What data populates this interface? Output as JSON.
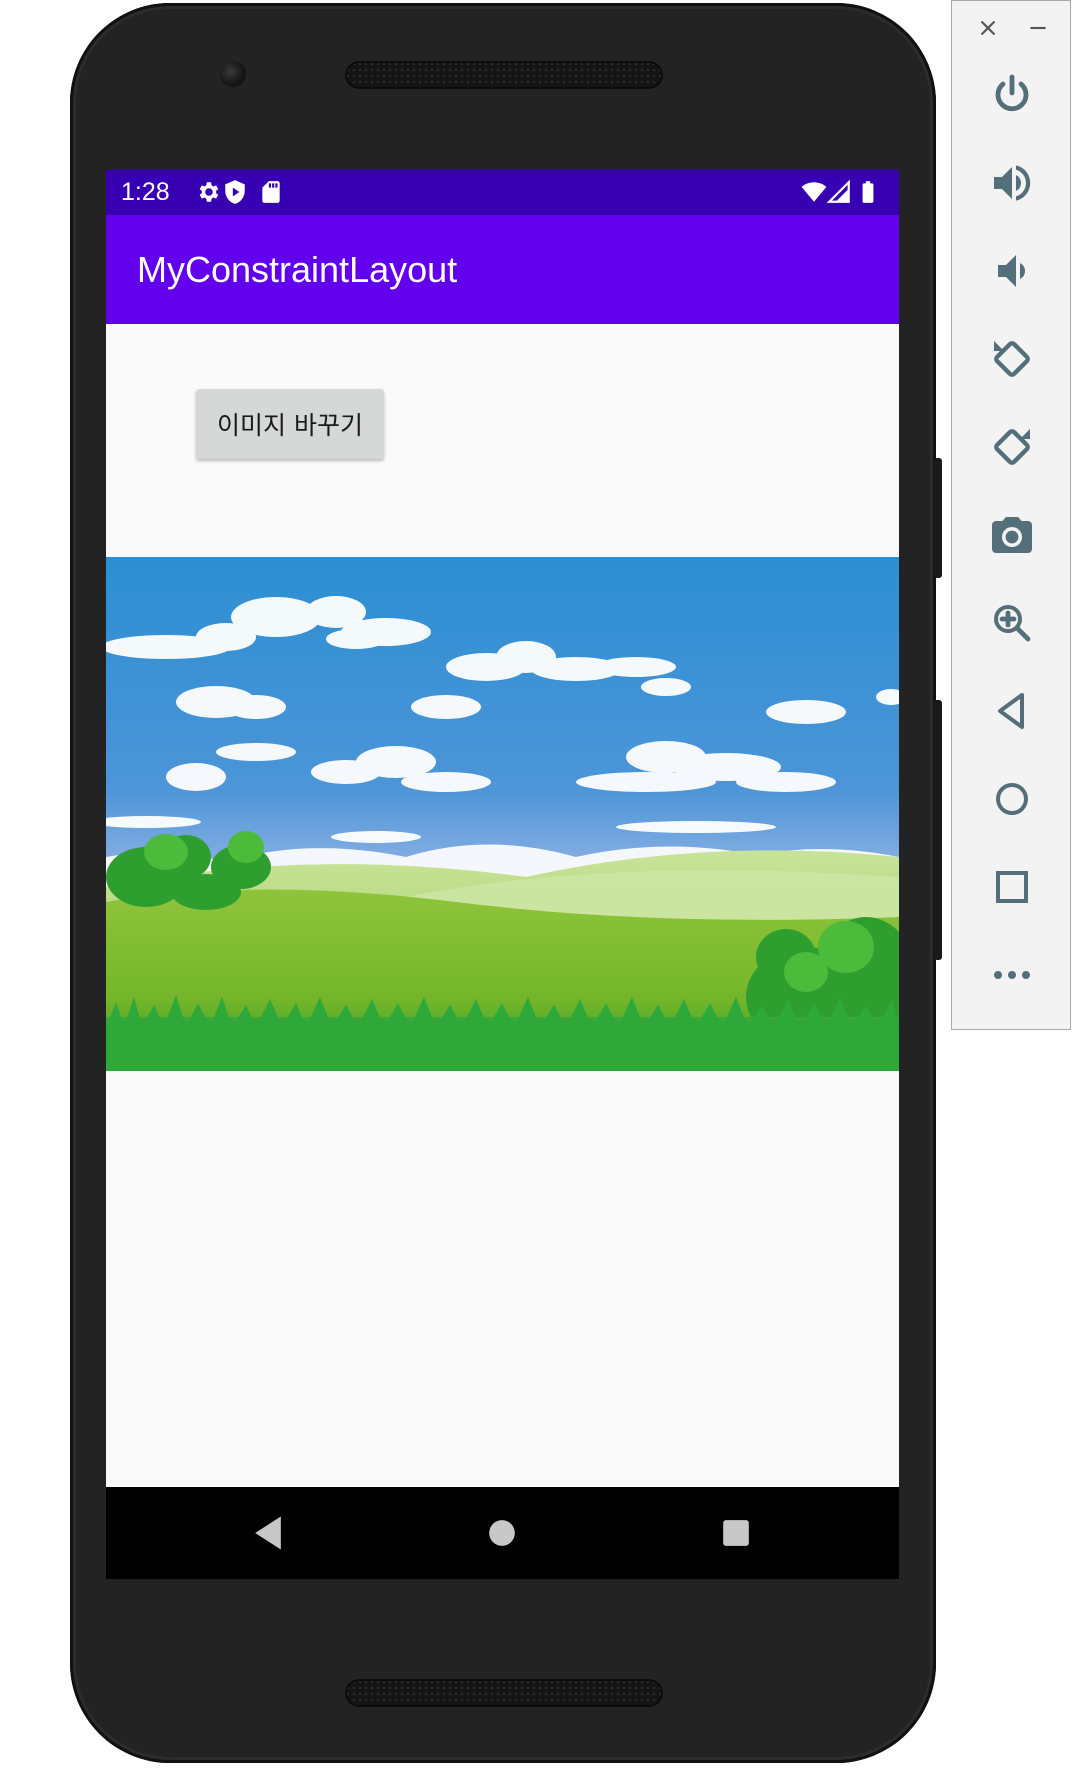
{
  "status_bar": {
    "time": "1:28",
    "icons": [
      "gear-icon",
      "shield-icon",
      "sd-card-icon",
      "wifi-icon",
      "signal-icon",
      "battery-icon"
    ]
  },
  "app_bar": {
    "title": "MyConstraintLayout"
  },
  "content": {
    "button_label": "이미지 바꾸기",
    "image": "landscape-sky-meadow"
  },
  "nav_bar": {
    "icons": [
      "back-icon",
      "home-icon",
      "recents-icon"
    ]
  },
  "emulator_panel": {
    "window_controls": [
      "close-icon",
      "minimize-icon"
    ],
    "tools": [
      "power-icon",
      "volume-up-icon",
      "volume-down-icon",
      "rotate-left-icon",
      "rotate-right-icon",
      "camera-icon",
      "zoom-icon",
      "back-icon",
      "home-icon",
      "overview-icon",
      "more-icon"
    ]
  },
  "colors": {
    "status_bar": "#3700b3",
    "app_bar": "#6200ee",
    "screen_bg": "#fafafa",
    "button_bg": "#d6d7d7",
    "nav_bar": "#000000",
    "panel_icon": "#546e7a"
  }
}
